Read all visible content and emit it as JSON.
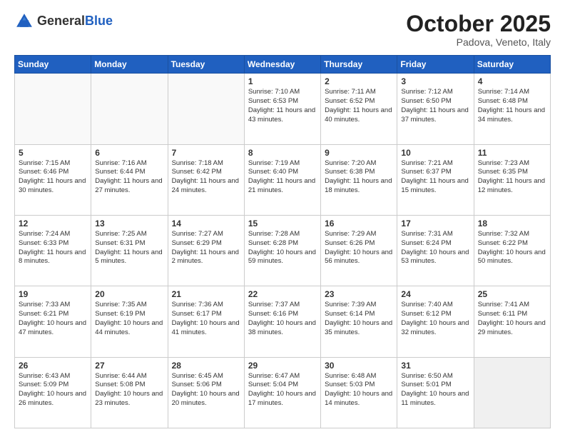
{
  "header": {
    "logo_line1": "General",
    "logo_line2": "Blue",
    "month": "October 2025",
    "location": "Padova, Veneto, Italy"
  },
  "weekdays": [
    "Sunday",
    "Monday",
    "Tuesday",
    "Wednesday",
    "Thursday",
    "Friday",
    "Saturday"
  ],
  "weeks": [
    [
      {
        "day": "",
        "info": ""
      },
      {
        "day": "",
        "info": ""
      },
      {
        "day": "",
        "info": ""
      },
      {
        "day": "1",
        "info": "Sunrise: 7:10 AM\nSunset: 6:53 PM\nDaylight: 11 hours\nand 43 minutes."
      },
      {
        "day": "2",
        "info": "Sunrise: 7:11 AM\nSunset: 6:52 PM\nDaylight: 11 hours\nand 40 minutes."
      },
      {
        "day": "3",
        "info": "Sunrise: 7:12 AM\nSunset: 6:50 PM\nDaylight: 11 hours\nand 37 minutes."
      },
      {
        "day": "4",
        "info": "Sunrise: 7:14 AM\nSunset: 6:48 PM\nDaylight: 11 hours\nand 34 minutes."
      }
    ],
    [
      {
        "day": "5",
        "info": "Sunrise: 7:15 AM\nSunset: 6:46 PM\nDaylight: 11 hours\nand 30 minutes."
      },
      {
        "day": "6",
        "info": "Sunrise: 7:16 AM\nSunset: 6:44 PM\nDaylight: 11 hours\nand 27 minutes."
      },
      {
        "day": "7",
        "info": "Sunrise: 7:18 AM\nSunset: 6:42 PM\nDaylight: 11 hours\nand 24 minutes."
      },
      {
        "day": "8",
        "info": "Sunrise: 7:19 AM\nSunset: 6:40 PM\nDaylight: 11 hours\nand 21 minutes."
      },
      {
        "day": "9",
        "info": "Sunrise: 7:20 AM\nSunset: 6:38 PM\nDaylight: 11 hours\nand 18 minutes."
      },
      {
        "day": "10",
        "info": "Sunrise: 7:21 AM\nSunset: 6:37 PM\nDaylight: 11 hours\nand 15 minutes."
      },
      {
        "day": "11",
        "info": "Sunrise: 7:23 AM\nSunset: 6:35 PM\nDaylight: 11 hours\nand 12 minutes."
      }
    ],
    [
      {
        "day": "12",
        "info": "Sunrise: 7:24 AM\nSunset: 6:33 PM\nDaylight: 11 hours\nand 8 minutes."
      },
      {
        "day": "13",
        "info": "Sunrise: 7:25 AM\nSunset: 6:31 PM\nDaylight: 11 hours\nand 5 minutes."
      },
      {
        "day": "14",
        "info": "Sunrise: 7:27 AM\nSunset: 6:29 PM\nDaylight: 11 hours\nand 2 minutes."
      },
      {
        "day": "15",
        "info": "Sunrise: 7:28 AM\nSunset: 6:28 PM\nDaylight: 10 hours\nand 59 minutes."
      },
      {
        "day": "16",
        "info": "Sunrise: 7:29 AM\nSunset: 6:26 PM\nDaylight: 10 hours\nand 56 minutes."
      },
      {
        "day": "17",
        "info": "Sunrise: 7:31 AM\nSunset: 6:24 PM\nDaylight: 10 hours\nand 53 minutes."
      },
      {
        "day": "18",
        "info": "Sunrise: 7:32 AM\nSunset: 6:22 PM\nDaylight: 10 hours\nand 50 minutes."
      }
    ],
    [
      {
        "day": "19",
        "info": "Sunrise: 7:33 AM\nSunset: 6:21 PM\nDaylight: 10 hours\nand 47 minutes."
      },
      {
        "day": "20",
        "info": "Sunrise: 7:35 AM\nSunset: 6:19 PM\nDaylight: 10 hours\nand 44 minutes."
      },
      {
        "day": "21",
        "info": "Sunrise: 7:36 AM\nSunset: 6:17 PM\nDaylight: 10 hours\nand 41 minutes."
      },
      {
        "day": "22",
        "info": "Sunrise: 7:37 AM\nSunset: 6:16 PM\nDaylight: 10 hours\nand 38 minutes."
      },
      {
        "day": "23",
        "info": "Sunrise: 7:39 AM\nSunset: 6:14 PM\nDaylight: 10 hours\nand 35 minutes."
      },
      {
        "day": "24",
        "info": "Sunrise: 7:40 AM\nSunset: 6:12 PM\nDaylight: 10 hours\nand 32 minutes."
      },
      {
        "day": "25",
        "info": "Sunrise: 7:41 AM\nSunset: 6:11 PM\nDaylight: 10 hours\nand 29 minutes."
      }
    ],
    [
      {
        "day": "26",
        "info": "Sunrise: 6:43 AM\nSunset: 5:09 PM\nDaylight: 10 hours\nand 26 minutes."
      },
      {
        "day": "27",
        "info": "Sunrise: 6:44 AM\nSunset: 5:08 PM\nDaylight: 10 hours\nand 23 minutes."
      },
      {
        "day": "28",
        "info": "Sunrise: 6:45 AM\nSunset: 5:06 PM\nDaylight: 10 hours\nand 20 minutes."
      },
      {
        "day": "29",
        "info": "Sunrise: 6:47 AM\nSunset: 5:04 PM\nDaylight: 10 hours\nand 17 minutes."
      },
      {
        "day": "30",
        "info": "Sunrise: 6:48 AM\nSunset: 5:03 PM\nDaylight: 10 hours\nand 14 minutes."
      },
      {
        "day": "31",
        "info": "Sunrise: 6:50 AM\nSunset: 5:01 PM\nDaylight: 10 hours\nand 11 minutes."
      },
      {
        "day": "",
        "info": ""
      }
    ]
  ]
}
